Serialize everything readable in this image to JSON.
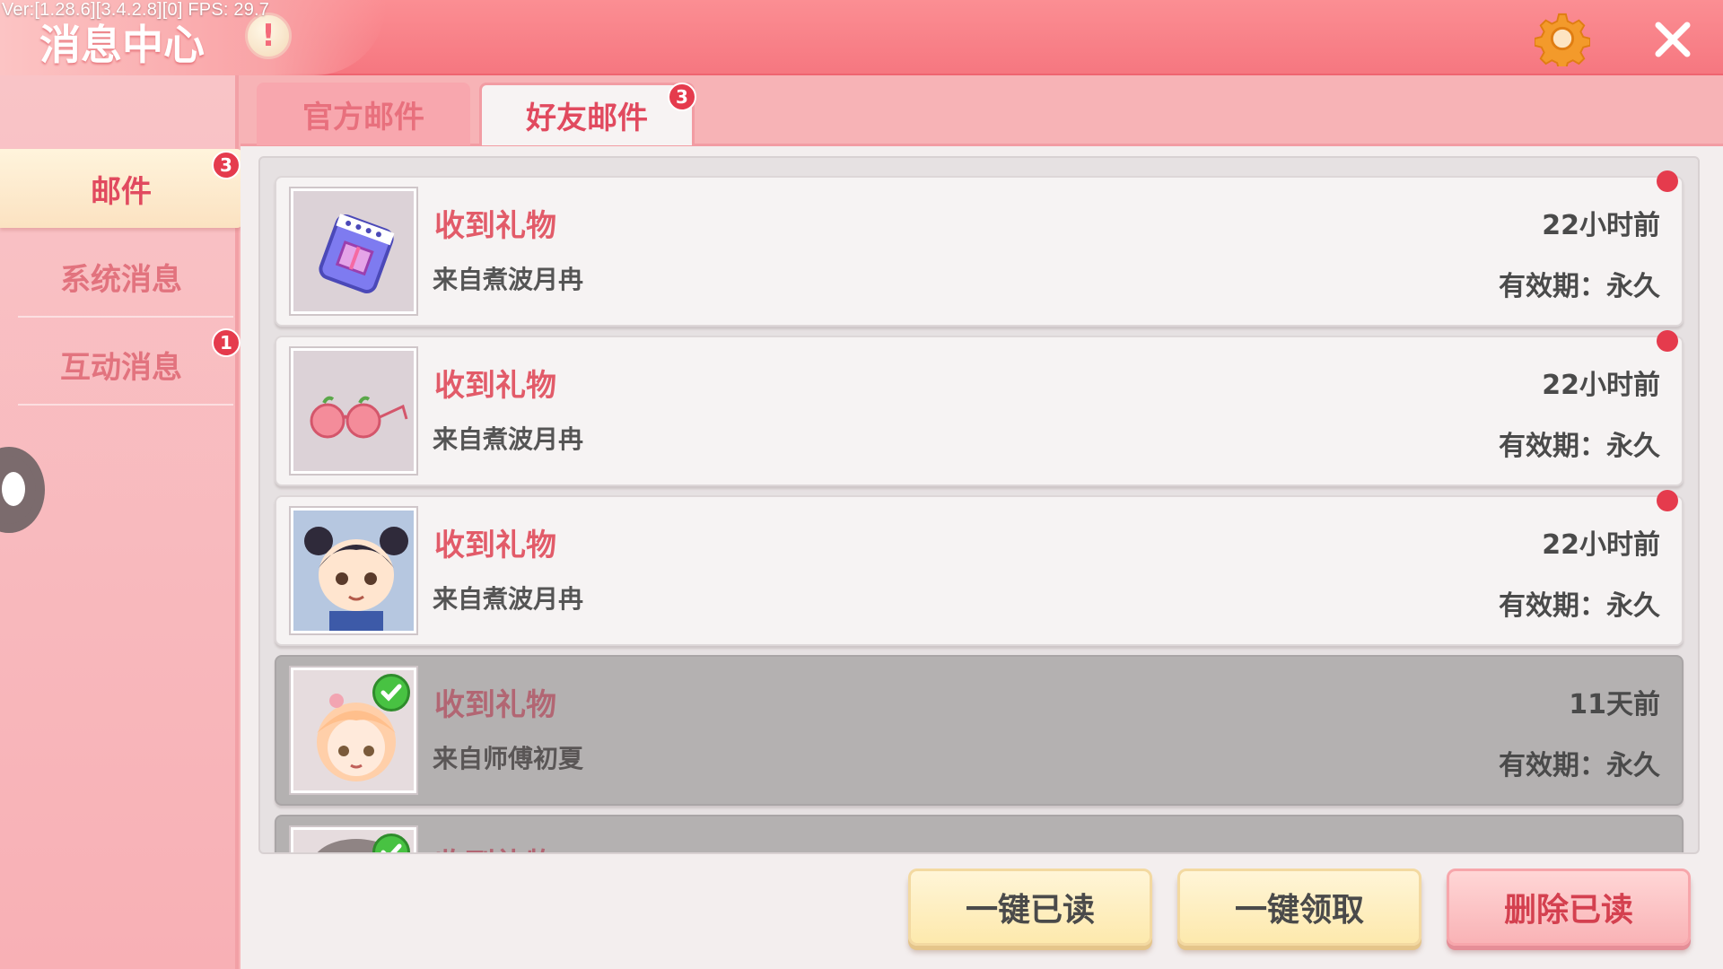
{
  "debug_text": "Ver:[1.28.6][3.4.2.8][0] FPS: 29.7",
  "header": {
    "title": "消息中心",
    "info_glyph": "!",
    "settings_icon": "gear-icon",
    "close_icon": "close-icon"
  },
  "sidebar": {
    "items": [
      {
        "label": "邮件",
        "badge": "3",
        "active": true
      },
      {
        "label": "系统消息",
        "badge": ""
      },
      {
        "label": "互动消息",
        "badge": "1"
      }
    ]
  },
  "tabs": [
    {
      "label": "官方邮件",
      "badge": ""
    },
    {
      "label": "好友邮件",
      "badge": "3",
      "active": true
    }
  ],
  "mails": [
    {
      "title": "收到礼物",
      "from": "来自煮波月冉",
      "time": "22小时前",
      "expiry": "有效期：永久",
      "read": false,
      "thumb": "gift-box-icon"
    },
    {
      "title": "收到礼物",
      "from": "来自煮波月冉",
      "time": "22小时前",
      "expiry": "有效期：永久",
      "read": false,
      "thumb": "peach-glasses-icon"
    },
    {
      "title": "收到礼物",
      "from": "来自煮波月冉",
      "time": "22小时前",
      "expiry": "有效期：永久",
      "read": false,
      "thumb": "chibi-avatar-icon"
    },
    {
      "title": "收到礼物",
      "from": "来自师傅初夏",
      "time": "11天前",
      "expiry": "有效期：永久",
      "read": true,
      "thumb": "chibi-girl-avatar-icon"
    },
    {
      "title": "收到礼物",
      "from": "",
      "time": "",
      "expiry": "",
      "read": true,
      "thumb": "avatar-icon"
    }
  ],
  "buttons": {
    "mark_all_read": "一键已读",
    "claim_all": "一键领取",
    "delete_read": "删除已读"
  },
  "colors": {
    "accent": "#f67780",
    "badge": "#e53b4d",
    "active_text": "#e14a5f"
  }
}
